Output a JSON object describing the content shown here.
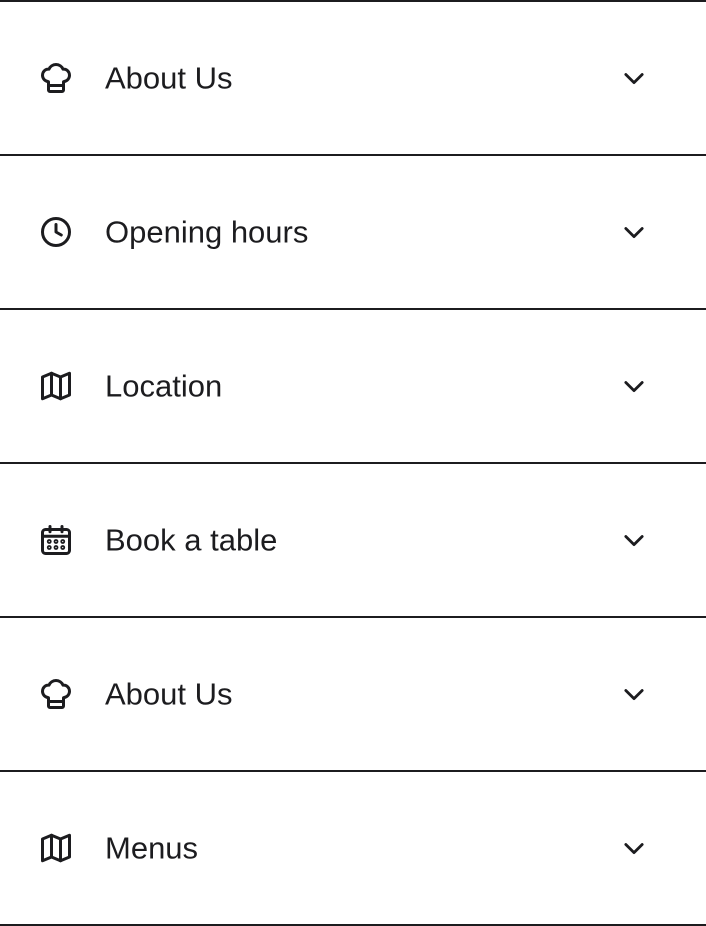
{
  "accordion": {
    "items": [
      {
        "label": "About Us",
        "icon": "chef-hat-icon"
      },
      {
        "label": "Opening hours",
        "icon": "clock-icon"
      },
      {
        "label": "Location",
        "icon": "map-icon"
      },
      {
        "label": "Book a table",
        "icon": "calendar-icon"
      },
      {
        "label": "About Us",
        "icon": "chef-hat-icon"
      },
      {
        "label": "Menus",
        "icon": "map-icon"
      }
    ],
    "expander_icon": "chevron-down-icon",
    "colors": {
      "text": "#1c1c1f",
      "divider": "#1c1c1f",
      "background": "#ffffff"
    }
  }
}
